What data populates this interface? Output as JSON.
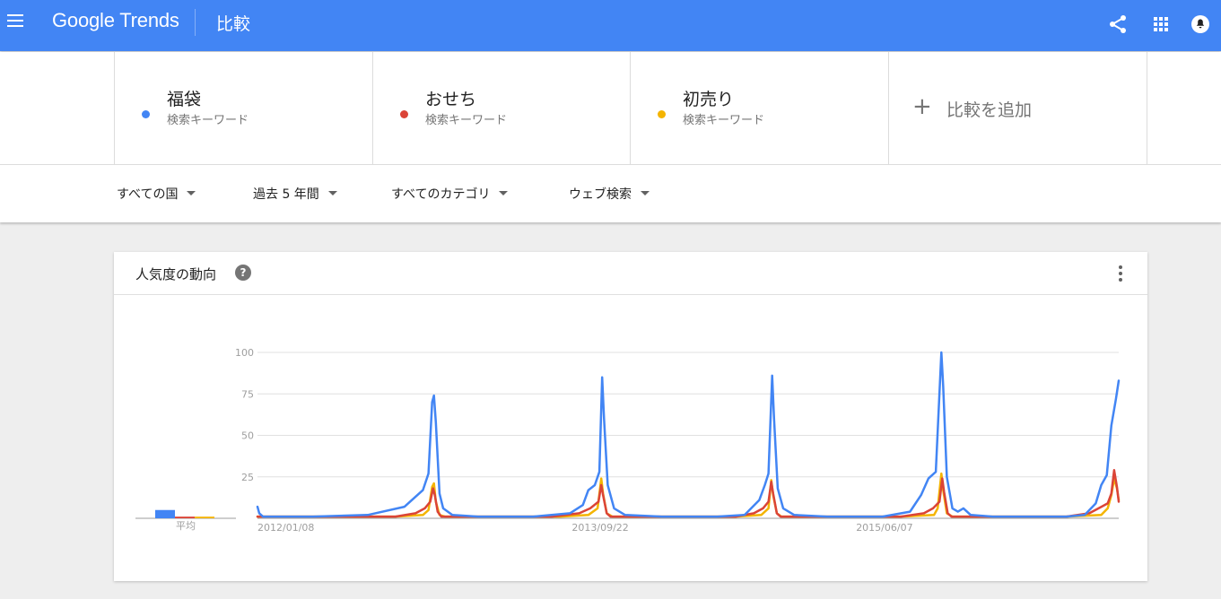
{
  "header": {
    "logo": "Google Trends",
    "page_title": "比較",
    "icons": [
      "menu-icon",
      "share-icon",
      "apps-icon",
      "account-icon"
    ]
  },
  "terms": [
    {
      "name": "福袋",
      "type": "検索キーワード",
      "color": "#4285f4"
    },
    {
      "name": "おせち",
      "type": "検索キーワード",
      "color": "#db4437"
    },
    {
      "name": "初売り",
      "type": "検索キーワード",
      "color": "#f4b400"
    }
  ],
  "add_compare": {
    "icon": "plus-icon",
    "label": "比較を追加"
  },
  "filters": [
    {
      "label": "すべての国"
    },
    {
      "label": "過去 5 年間"
    },
    {
      "label": "すべてのカテゴリ"
    },
    {
      "label": "ウェブ検索"
    }
  ],
  "card": {
    "title": "人気度の動向",
    "help_icon": "help-icon",
    "more_icon": "more-vert-icon"
  },
  "chart_data": {
    "type": "line",
    "title": "",
    "xlabel": "",
    "ylabel": "",
    "ylim": [
      0,
      100
    ],
    "y_ticks": [
      100,
      75,
      50,
      25
    ],
    "x_tick_labels": [
      "2012/01/08",
      "2013/09/22",
      "2015/06/07"
    ],
    "average_label": "平均",
    "average": {
      "福袋": 5,
      "おせち": 1,
      "初売り": 1
    },
    "grid": true,
    "series": [
      {
        "name": "福袋",
        "color": "#4285f4",
        "points": [
          [
            0,
            7
          ],
          [
            2,
            3
          ],
          [
            6,
            1
          ],
          [
            30,
            1
          ],
          [
            60,
            1
          ],
          [
            120,
            2
          ],
          [
            160,
            7
          ],
          [
            172,
            13
          ],
          [
            180,
            17
          ],
          [
            186,
            27
          ],
          [
            190,
            70
          ],
          [
            192,
            74
          ],
          [
            194,
            58
          ],
          [
            198,
            15
          ],
          [
            202,
            6
          ],
          [
            212,
            2
          ],
          [
            240,
            1
          ],
          [
            300,
            1
          ],
          [
            340,
            3
          ],
          [
            354,
            8
          ],
          [
            360,
            17
          ],
          [
            367,
            20
          ],
          [
            372,
            28
          ],
          [
            375,
            85
          ],
          [
            377,
            60
          ],
          [
            381,
            20
          ],
          [
            388,
            6
          ],
          [
            400,
            2
          ],
          [
            440,
            1
          ],
          [
            500,
            1
          ],
          [
            530,
            2
          ],
          [
            546,
            11
          ],
          [
            552,
            20
          ],
          [
            556,
            27
          ],
          [
            560,
            86
          ],
          [
            562,
            60
          ],
          [
            566,
            18
          ],
          [
            572,
            6
          ],
          [
            584,
            2
          ],
          [
            620,
            1
          ],
          [
            680,
            1
          ],
          [
            710,
            4
          ],
          [
            722,
            14
          ],
          [
            730,
            24
          ],
          [
            738,
            28
          ],
          [
            744,
            100
          ],
          [
            746,
            80
          ],
          [
            750,
            25
          ],
          [
            756,
            6
          ],
          [
            762,
            4
          ],
          [
            768,
            6
          ],
          [
            776,
            2
          ],
          [
            800,
            1
          ],
          [
            880,
            1
          ],
          [
            900,
            2
          ],
          [
            912,
            9
          ],
          [
            918,
            20
          ],
          [
            924,
            26
          ],
          [
            929,
            56
          ],
          [
            934,
            72
          ],
          [
            937,
            83
          ]
        ]
      },
      {
        "name": "おせち",
        "color": "#db4437",
        "points": [
          [
            0,
            1
          ],
          [
            120,
            1
          ],
          [
            150,
            1
          ],
          [
            172,
            3
          ],
          [
            182,
            6
          ],
          [
            188,
            10
          ],
          [
            191,
            18
          ],
          [
            193,
            14
          ],
          [
            196,
            4
          ],
          [
            200,
            1
          ],
          [
            320,
            1
          ],
          [
            350,
            3
          ],
          [
            362,
            6
          ],
          [
            371,
            10
          ],
          [
            374,
            20
          ],
          [
            376,
            14
          ],
          [
            380,
            3
          ],
          [
            384,
            1
          ],
          [
            520,
            1
          ],
          [
            540,
            3
          ],
          [
            550,
            6
          ],
          [
            556,
            10
          ],
          [
            559,
            22
          ],
          [
            561,
            15
          ],
          [
            565,
            3
          ],
          [
            569,
            1
          ],
          [
            700,
            1
          ],
          [
            725,
            3
          ],
          [
            735,
            6
          ],
          [
            742,
            10
          ],
          [
            745,
            24
          ],
          [
            747,
            16
          ],
          [
            751,
            3
          ],
          [
            755,
            1
          ],
          [
            880,
            1
          ],
          [
            905,
            3
          ],
          [
            915,
            6
          ],
          [
            925,
            9
          ],
          [
            929,
            15
          ],
          [
            932,
            29
          ],
          [
            935,
            19
          ],
          [
            937,
            10
          ]
        ]
      },
      {
        "name": "初売り",
        "color": "#f4b400",
        "points": [
          [
            0,
            1
          ],
          [
            150,
            1
          ],
          [
            180,
            2
          ],
          [
            186,
            5
          ],
          [
            190,
            19
          ],
          [
            192,
            21
          ],
          [
            194,
            10
          ],
          [
            198,
            2
          ],
          [
            204,
            1
          ],
          [
            330,
            1
          ],
          [
            360,
            2
          ],
          [
            370,
            6
          ],
          [
            374,
            24
          ],
          [
            376,
            15
          ],
          [
            380,
            3
          ],
          [
            386,
            1
          ],
          [
            520,
            1
          ],
          [
            548,
            2
          ],
          [
            556,
            6
          ],
          [
            559,
            23
          ],
          [
            561,
            14
          ],
          [
            565,
            3
          ],
          [
            570,
            1
          ],
          [
            700,
            1
          ],
          [
            736,
            2
          ],
          [
            740,
            6
          ],
          [
            744,
            27
          ],
          [
            746,
            17
          ],
          [
            750,
            3
          ],
          [
            756,
            1
          ],
          [
            880,
            1
          ],
          [
            918,
            2
          ],
          [
            925,
            6
          ],
          [
            929,
            14
          ],
          [
            932,
            24
          ],
          [
            935,
            18
          ],
          [
            937,
            11
          ]
        ]
      }
    ]
  }
}
